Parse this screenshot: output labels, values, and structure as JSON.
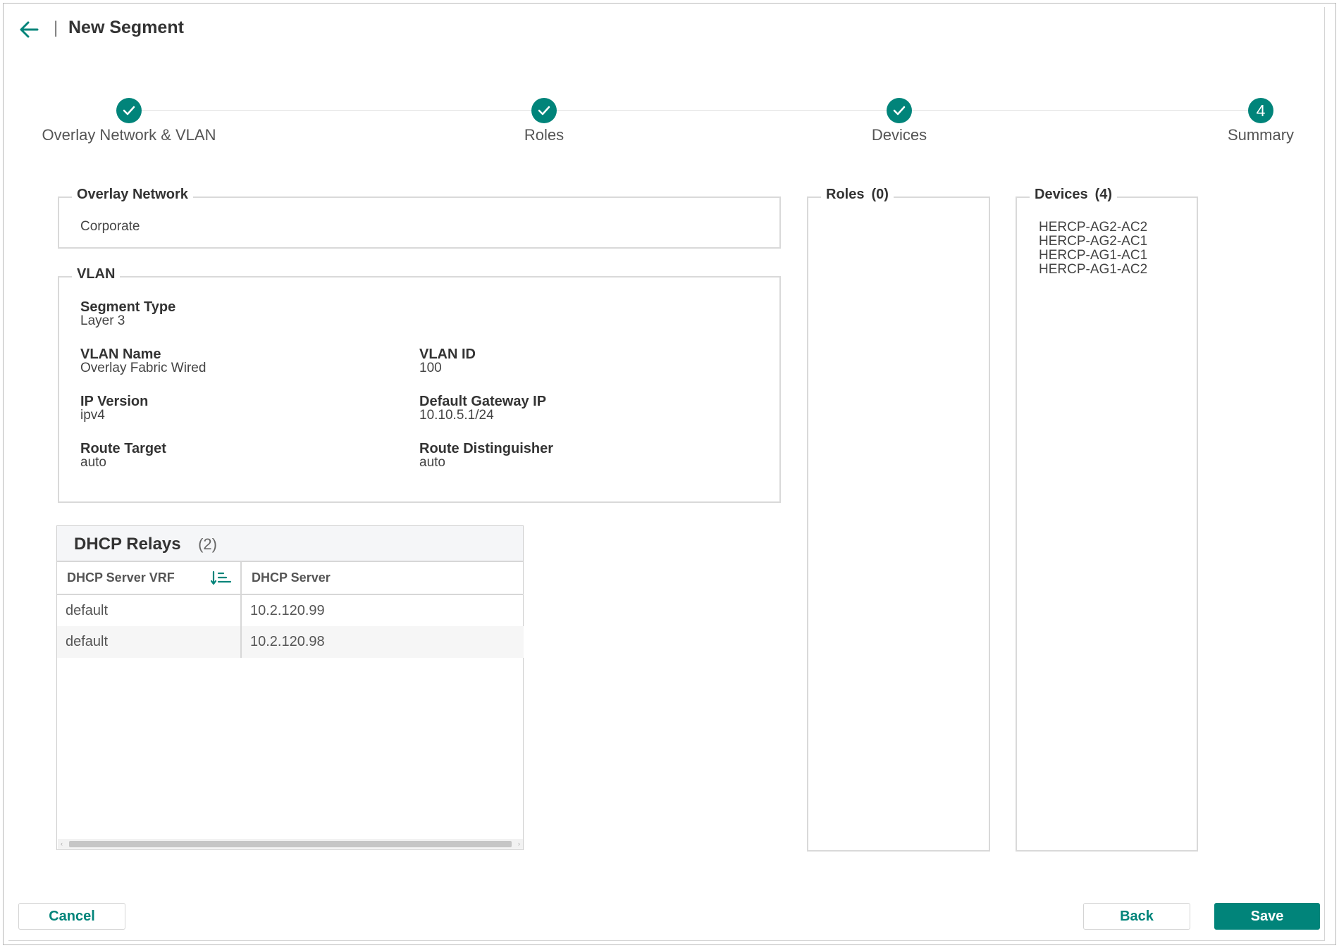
{
  "header": {
    "title": "New Segment",
    "separator": "|"
  },
  "stepper": {
    "steps": [
      {
        "label": "Overlay Network & VLAN",
        "state": "complete",
        "icon": "check-icon"
      },
      {
        "label": "Roles",
        "state": "complete",
        "icon": "check-icon"
      },
      {
        "label": "Devices",
        "state": "complete",
        "icon": "check-icon"
      },
      {
        "label": "Summary",
        "state": "current",
        "number": "4"
      }
    ]
  },
  "overlay_network": {
    "legend": "Overlay Network",
    "value": "Corporate"
  },
  "vlan": {
    "legend": "VLAN",
    "segment_type": {
      "label": "Segment Type",
      "value": "Layer 3"
    },
    "vlan_name": {
      "label": "VLAN Name",
      "value": "Overlay Fabric Wired"
    },
    "vlan_id": {
      "label": "VLAN ID",
      "value": "100"
    },
    "ip_version": {
      "label": "IP Version",
      "value": "ipv4"
    },
    "default_gateway": {
      "label": "Default Gateway IP",
      "value": "10.10.5.1/24"
    },
    "route_target": {
      "label": "Route Target",
      "value": "auto"
    },
    "route_distinguisher": {
      "label": "Route Distinguisher",
      "value": "auto"
    }
  },
  "roles": {
    "legend": "Roles",
    "count": "(0)",
    "items": []
  },
  "devices": {
    "legend": "Devices",
    "count": "(4)",
    "items": [
      "HERCP-AG2-AC2",
      "HERCP-AG2-AC1",
      "HERCP-AG1-AC1",
      "HERCP-AG1-AC2"
    ]
  },
  "dhcp_relays": {
    "title": "DHCP Relays",
    "count": "(2)",
    "columns": [
      "DHCP Server VRF",
      "DHCP Server"
    ],
    "rows": [
      [
        "default",
        "10.2.120.99"
      ],
      [
        "default",
        "10.2.120.98"
      ]
    ]
  },
  "footer": {
    "cancel_label": "Cancel",
    "back_label": "Back",
    "save_label": "Save"
  },
  "colors": {
    "accent": "#01847a",
    "border": "#d9d9d9",
    "text": "#333333"
  }
}
